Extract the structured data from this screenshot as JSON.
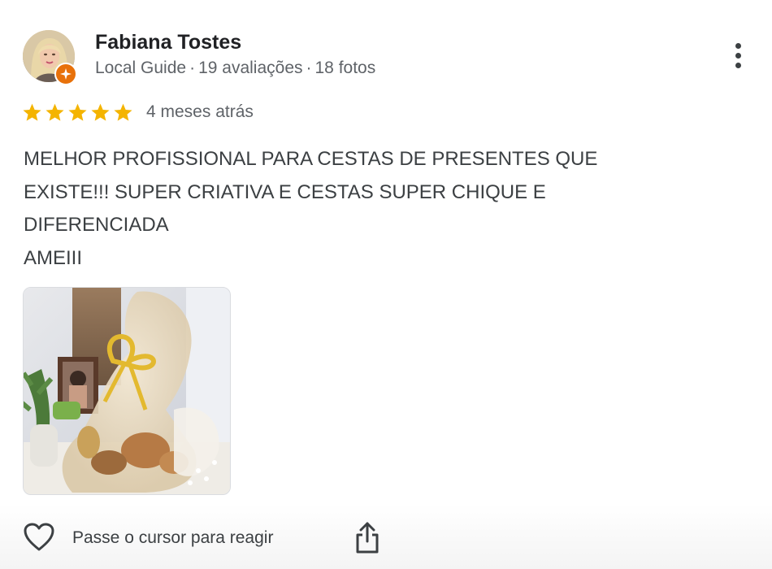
{
  "reviewer": {
    "name": "Fabiana Tostes",
    "badge": "Local Guide",
    "reviews_count": "19 avaliações",
    "photos_count": "18 fotos",
    "separator": "·",
    "badge_color": "#e8710a"
  },
  "rating": {
    "value": 5,
    "max": 5,
    "star_color": "#f4b400",
    "time_ago": "4 meses atrás"
  },
  "review": {
    "lines": [
      "MELHOR PROFISSIONAL PARA CESTAS DE PRESENTES QUE",
      "EXISTE!!! SUPER CRIATIVA E CESTAS SUPER CHIQUE E",
      "DIFERENCIADA",
      "AMEIII"
    ]
  },
  "photo": {
    "icon": "photo-gift-basket"
  },
  "actions": {
    "react_label": "Passe o cursor para reagir",
    "react_icon": "heart-icon",
    "share_icon": "share-icon",
    "more_icon": "more-vert-icon"
  }
}
